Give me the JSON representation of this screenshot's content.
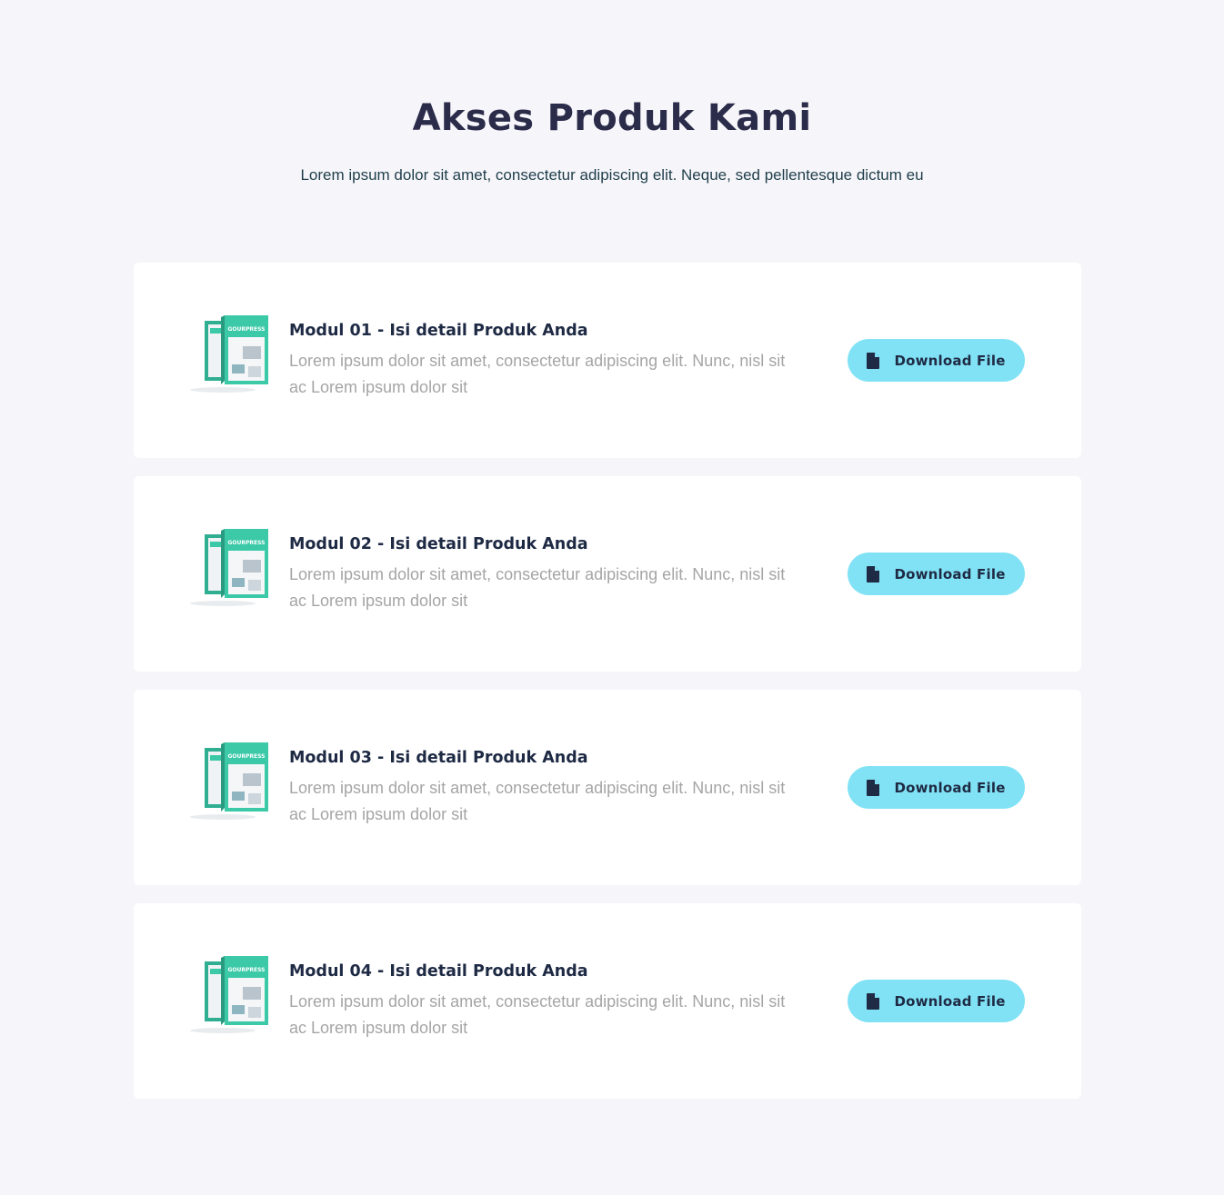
{
  "header": {
    "title": "Akses Produk Kami",
    "subtitle": "Lorem ipsum dolor sit amet, consectetur adipiscing elit. Neque, sed pellentesque dictum eu"
  },
  "modules": [
    {
      "title": "Modul 01 - Isi detail Produk Anda",
      "description": "Lorem ipsum dolor sit amet, consectetur adipiscing elit. Nunc, nisl sit ac Lorem ipsum dolor sit",
      "button_label": "Download File",
      "button_icon": "file-icon",
      "image_label": "GOURPRESS"
    },
    {
      "title": "Modul 02 - Isi detail Produk Anda",
      "description": "Lorem ipsum dolor sit amet, consectetur adipiscing elit. Nunc, nisl sit ac Lorem ipsum dolor sit",
      "button_label": "Download File",
      "button_icon": "file-icon",
      "image_label": "GOURPRESS"
    },
    {
      "title": "Modul 03 - Isi detail Produk Anda",
      "description": "Lorem ipsum dolor sit amet, consectetur adipiscing elit. Nunc, nisl sit ac Lorem ipsum dolor sit",
      "button_label": "Download File",
      "button_icon": "file-icon",
      "image_label": "GOURPRESS"
    },
    {
      "title": "Modul 04 - Isi detail Produk Anda",
      "description": "Lorem ipsum dolor sit amet, consectetur adipiscing elit. Nunc, nisl sit ac Lorem ipsum dolor sit",
      "button_label": "Download File",
      "button_icon": "file-icon",
      "image_label": "GOURPRESS"
    }
  ],
  "colors": {
    "background": "#f6f6fa",
    "card": "#ffffff",
    "button": "#81e2f5",
    "title": "#2b2c4a",
    "description": "#a5a5a5",
    "product_box": "#3cc9a7"
  }
}
